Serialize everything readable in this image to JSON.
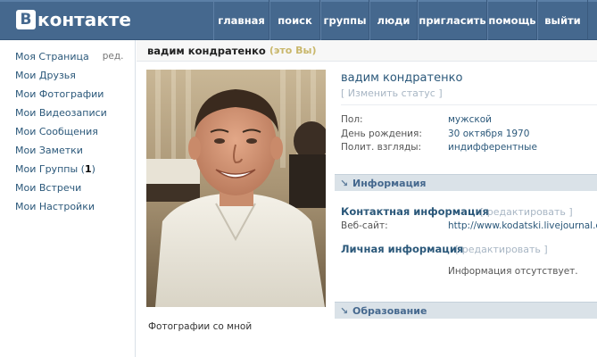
{
  "header": {
    "logo_letter": "В",
    "logo_text": "контакте",
    "nav": [
      "главная",
      "поиск",
      "группы",
      "люди",
      "пригласить",
      "помощь",
      "выйти"
    ]
  },
  "sidebar": {
    "my_page": "Моя Страница",
    "my_page_edit": "ред.",
    "items": [
      "Мои Друзья",
      "Мои Фотографии",
      "Мои Видеозаписи",
      "Мои Сообщения",
      "Мои Заметки"
    ],
    "groups_label": "Мои Группы (",
    "groups_count": "1",
    "groups_close": ")",
    "items2": [
      "Мои Встречи",
      "Мои Настройки"
    ]
  },
  "title_bar": {
    "name": "вадим кондратенко",
    "you": "(это Вы)"
  },
  "profile": {
    "name": "вадим кондратенко",
    "change_status": "[ Изменить статус ]",
    "fields": [
      {
        "label": "Пол:",
        "value": "мужской"
      },
      {
        "label": "День рождения:",
        "value": "30 октября 1970"
      },
      {
        "label": "Полит. взгляды:",
        "value": "индифферентные"
      }
    ]
  },
  "photo_caption": "Фотографии со мной",
  "info_section": {
    "header": "Информация",
    "contact_title": "Контактная информация",
    "contact_edit": "[ редактировать ]",
    "website_label": "Веб-сайт:",
    "website_value": "http://www.kodatski.livejournal.com",
    "personal_title": "Личная информация",
    "personal_edit": "[ редактировать ]",
    "personal_empty": "Информация отсутствует."
  },
  "education_section": {
    "header": "Образование"
  },
  "colors": {
    "header_bg": "#45688e",
    "link": "#2b587a",
    "section_bg": "#dae2e8"
  }
}
